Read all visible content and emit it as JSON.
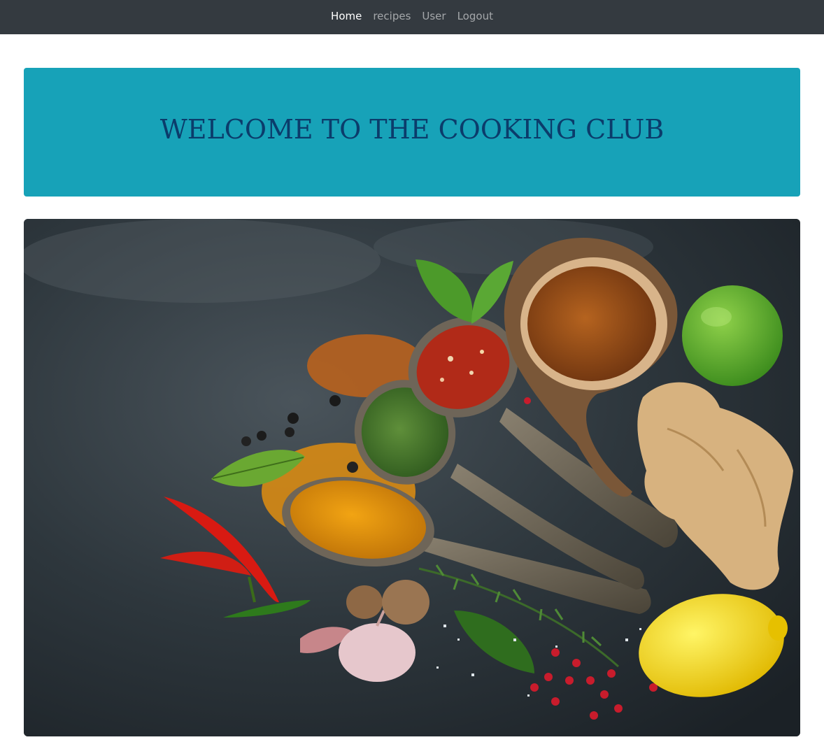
{
  "nav": {
    "items": [
      {
        "label": "Home",
        "active": true
      },
      {
        "label": "recipes",
        "active": false
      },
      {
        "label": "User",
        "active": false
      },
      {
        "label": "Logout",
        "active": false
      }
    ]
  },
  "hero": {
    "title": "WELCOME TO THE COOKING CLUB"
  },
  "colors": {
    "navbar_bg": "#343a40",
    "jumbotron_bg": "#17a2b8",
    "title_color": "#0b3c6b"
  },
  "image": {
    "subject": "spices-photo"
  }
}
